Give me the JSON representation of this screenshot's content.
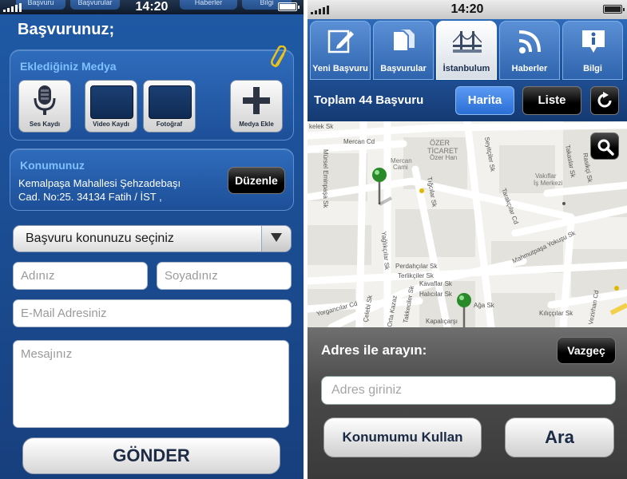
{
  "left_screen": {
    "status": {
      "time": "14:20"
    },
    "top_tabs": [
      "Başvuru",
      "Başvurular",
      "",
      "Haberler",
      "Bilgi"
    ],
    "title": "Başvurunuz;",
    "media": {
      "title": "Eklediğiniz Medya",
      "buttons": [
        {
          "label": "Ses Kaydı",
          "icon": "microphone-icon"
        },
        {
          "label": "Video Kaydı",
          "icon": "video-placeholder"
        },
        {
          "label": "Fotoğraf",
          "icon": "photo-placeholder"
        },
        {
          "label": "Medya Ekle",
          "icon": "plus-icon"
        }
      ]
    },
    "location": {
      "title": "Konumunuz",
      "address_line1": "Kemalpaşa Mahallesi Şehzadebaşı",
      "address_line2": "Cad. No:25. 34134 Fatih / İST ,",
      "edit_label": "Düzenle"
    },
    "subject_select": {
      "value": "Başvuru konunuzu seçiniz"
    },
    "form": {
      "first_name_placeholder": "Adınız",
      "last_name_placeholder": "Soyadınız",
      "email_placeholder": "E-Mail Adresiniz",
      "message_placeholder": "Mesajınız"
    },
    "submit_label": "GÖNDER"
  },
  "right_screen": {
    "status": {
      "time": "14:20"
    },
    "tabs": [
      {
        "label": "Yeni Başvuru",
        "icon": "edit-icon",
        "active": false
      },
      {
        "label": "Başvurular",
        "icon": "documents-icon",
        "active": false
      },
      {
        "label": "İstanbulum",
        "icon": "bridge-icon",
        "active": true
      },
      {
        "label": "Haberler",
        "icon": "rss-icon",
        "active": false
      },
      {
        "label": "Bilgi",
        "icon": "info-icon",
        "active": false
      }
    ],
    "toolbar": {
      "count_text": "Toplam 44 Başvuru",
      "map_label": "Harita",
      "list_label": "Liste"
    },
    "map": {
      "labels": {
        "kelek": "kelek Sk",
        "mercan": "Mercan Cd",
        "ozer1": "ÖZER",
        "ozer2": "TİCARET",
        "ozer3": "Özer Han",
        "mercan_cami1": "Mercan",
        "mercan_cami2": "Cami",
        "emin": "Mürsel Eminpaşa Sk",
        "vakiflar1": "Vakıflar",
        "vakiflar2": "İş Merkezi",
        "tiglici": "Tığcılar Sk",
        "takaslar": "Takaslar Sk",
        "rasikop": "Rasikçi Sk",
        "yagl": "Yağlıkçılar Sk",
        "taracilar": "Tarakçılar Cd",
        "seyit": "Seyitçiler Sk",
        "mahmut": "Mahmutpaşa Yokuşu Sk",
        "perdah": "Perdahçılar Sk",
        "terlik": "Terlikçiler Sk",
        "kavaf": "Kavaflar Sk",
        "halicilar": "Halıcılar Sk",
        "aga": "Ağa Sk",
        "yorgan": "Yorgancılar Cd",
        "celebi": "Çelebi Sk",
        "takke": "Takkeciler Sk",
        "orta": "Orta Kazaz",
        "kapal": "Kapalıçarşı",
        "kilic": "Kılıççılar Sk",
        "vezir": "Vezirhan Cd"
      }
    },
    "address_sheet": {
      "title": "Adres ile arayın:",
      "cancel_label": "Vazgeç",
      "input_placeholder": "Adres giriniz",
      "use_location_label": "Konumumu Kullan",
      "search_label": "Ara"
    }
  }
}
